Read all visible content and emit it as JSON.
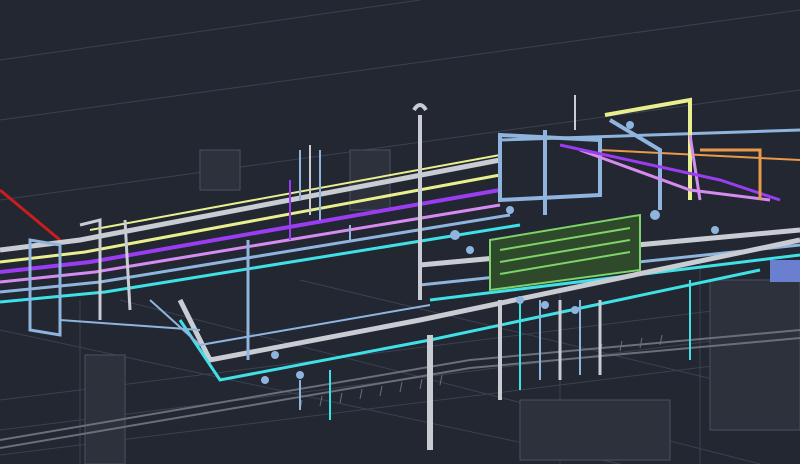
{
  "viewport": {
    "background": "#222731",
    "render_mode": "wireframe-3d-piping-model",
    "layers": [
      {
        "name": "grid",
        "color": "#3a4150"
      },
      {
        "name": "structure",
        "color": "#5a6070"
      },
      {
        "name": "pipe-grey",
        "color": "#c9ccd2"
      },
      {
        "name": "pipe-blue",
        "color": "#8fb4dd"
      },
      {
        "name": "pipe-cyan",
        "color": "#3fe0e6"
      },
      {
        "name": "pipe-purple",
        "color": "#9a3cf0"
      },
      {
        "name": "pipe-violet",
        "color": "#d58bf0"
      },
      {
        "name": "pipe-yellow",
        "color": "#e9ef8f"
      },
      {
        "name": "pipe-orange",
        "color": "#e89a4a"
      },
      {
        "name": "pipe-green",
        "color": "#7ed36a"
      },
      {
        "name": "pipe-red",
        "color": "#c81e1e"
      }
    ]
  }
}
